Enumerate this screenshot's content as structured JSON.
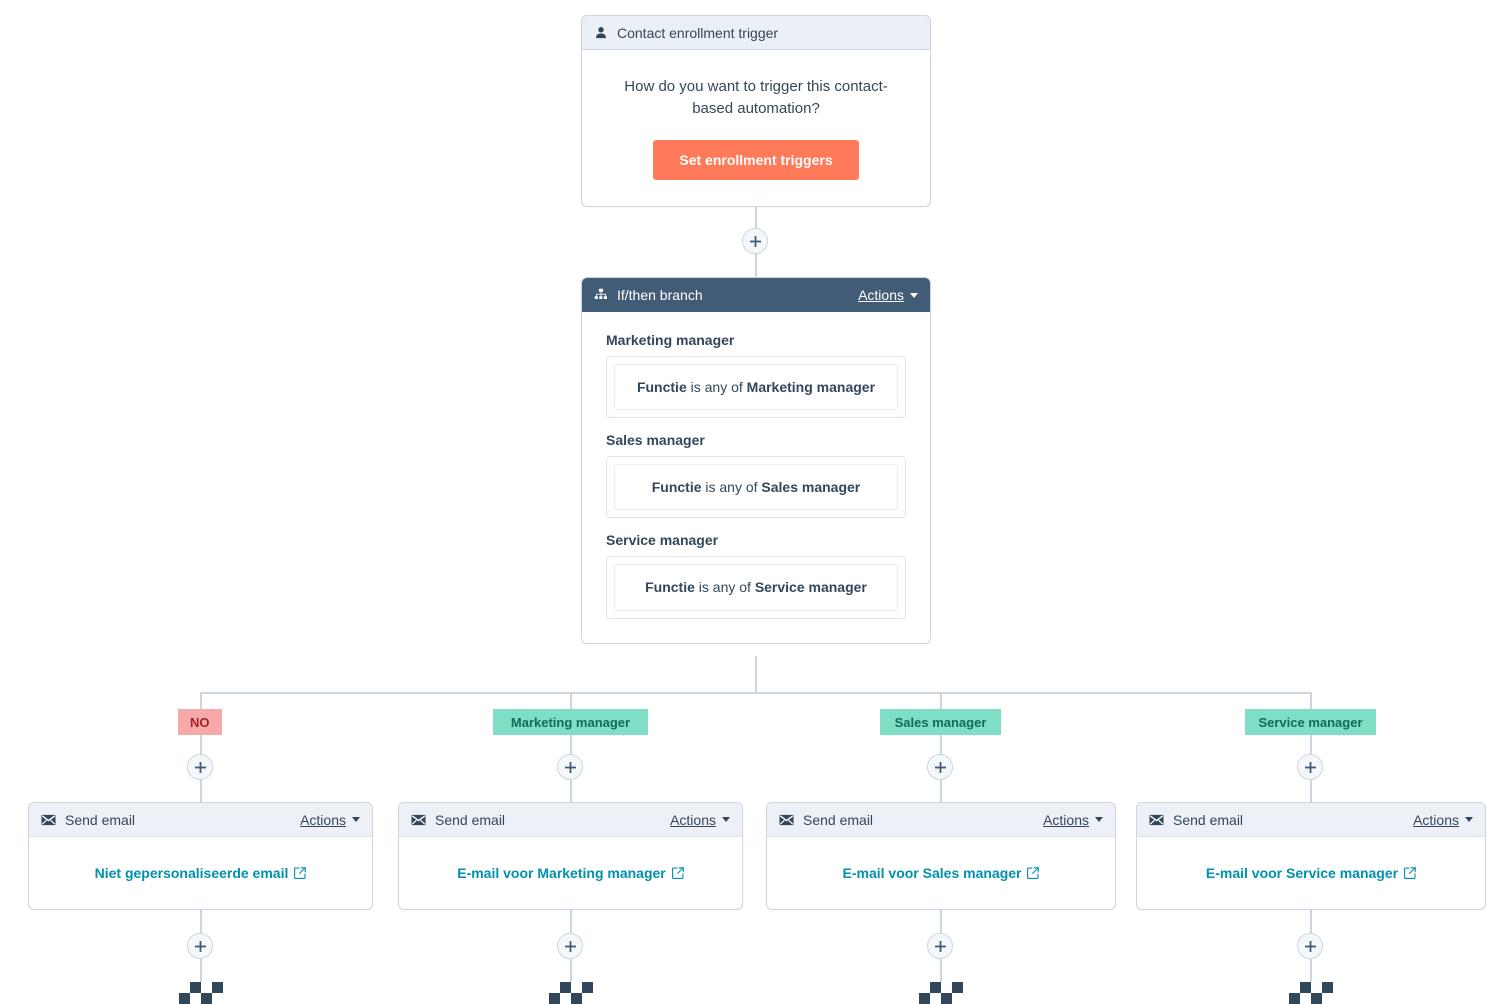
{
  "trigger": {
    "header_title": "Contact enrollment trigger",
    "icon": "contact-person-icon",
    "question": "How do you want to trigger this contact-based automation?",
    "button_label": "Set enrollment triggers",
    "button_color": "#ff7a59"
  },
  "branch": {
    "header_title": "If/then branch",
    "icon": "sitemap-icon",
    "actions_label": "Actions",
    "header_color": "#425b76",
    "groups": [
      {
        "name": "Marketing manager",
        "condition_property": "Functie",
        "condition_operator": "is any of",
        "condition_value": "Marketing manager"
      },
      {
        "name": "Sales manager",
        "condition_property": "Functie",
        "condition_operator": "is any of",
        "condition_value": "Sales manager"
      },
      {
        "name": "Service manager",
        "condition_property": "Functie",
        "condition_operator": "is any of",
        "condition_value": "Service manager"
      }
    ]
  },
  "branch_paths": [
    {
      "badge_label": "NO",
      "badge_type": "no",
      "badge_bg": "#f7a9a9",
      "badge_color": "#a4222a",
      "email_header_title": "Send email",
      "email_actions_label": "Actions",
      "email_name": "Niet gepersonaliseerde email"
    },
    {
      "badge_label": "Marketing manager",
      "badge_type": "branch",
      "badge_bg": "#7fdec5",
      "badge_color": "#0e6e5c",
      "email_header_title": "Send email",
      "email_actions_label": "Actions",
      "email_name": "E-mail voor Marketing manager"
    },
    {
      "badge_label": "Sales manager",
      "badge_type": "branch",
      "badge_bg": "#7fdec5",
      "badge_color": "#0e6e5c",
      "email_header_title": "Send email",
      "email_actions_label": "Actions",
      "email_name": "E-mail voor Sales manager"
    },
    {
      "badge_label": "Service manager",
      "badge_type": "branch",
      "badge_bg": "#7fdec5",
      "badge_color": "#0e6e5c",
      "email_header_title": "Send email",
      "email_actions_label": "Actions",
      "email_name": "E-mail voor Service manager"
    }
  ],
  "connectors": {
    "add_step_icon": "plus-icon",
    "end_marker_icon": "checkered-flag-icon"
  }
}
